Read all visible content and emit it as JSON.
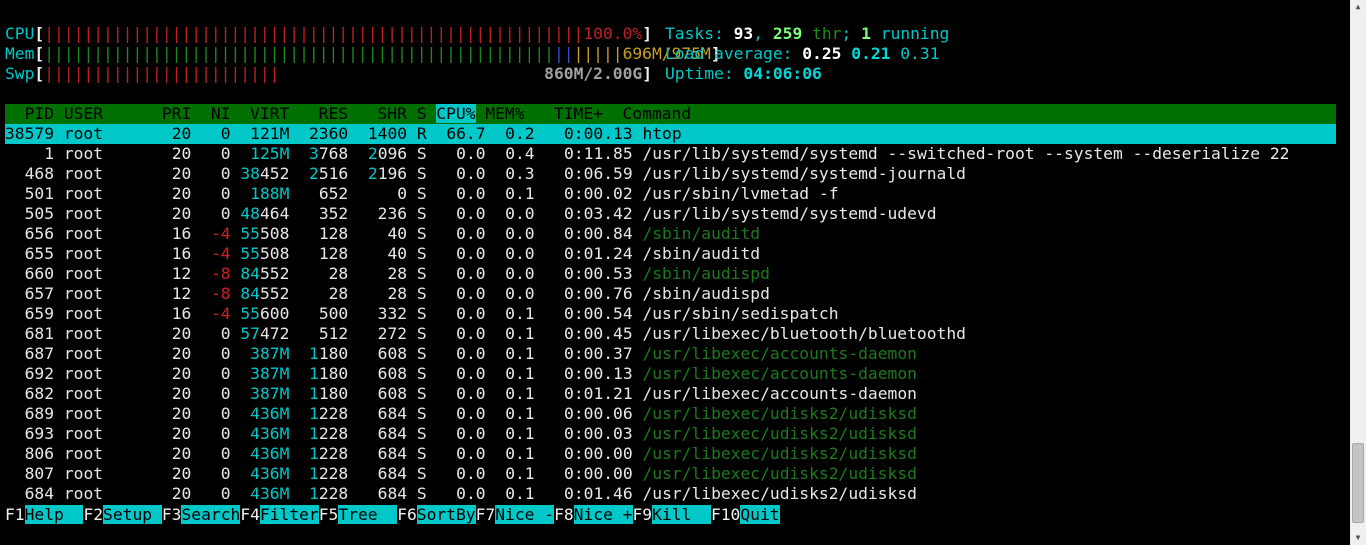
{
  "meters": {
    "cpu": {
      "label": "CPU",
      "bars": "|||||||||||||||||||||||||||||||||||||||||||||||||||||||",
      "value": "100.0%",
      "color": "#c02020"
    },
    "mem": {
      "label": "Mem",
      "bars_used": "||||||||||||||||||||||||||||||||||||||||||||||||||||",
      "bars_buffers": "||",
      "bars_cache": "|||||",
      "value": "696M/975M",
      "colors": {
        "used": "#1c8a1c",
        "buffers": "#3050d0",
        "cache": "#c8a020"
      }
    },
    "swp": {
      "label": "Swp",
      "bars": "||||||||||||||||||||||||",
      "value": "860M/2.00G",
      "color": "#c02020"
    },
    "open_bracket": "[",
    "close_bracket": "]"
  },
  "summary": {
    "tasks_label": "Tasks: ",
    "tasks_count": "93",
    "tasks_sep": ", ",
    "threads": "259",
    "threads_label": " thr",
    "running_sep": "; ",
    "running": "1",
    "running_label": " running",
    "load_label": "Load average: ",
    "load1": "0.25",
    "load5": "0.21",
    "load15": "0.31",
    "uptime_label": "Uptime: ",
    "uptime": "04:06:06"
  },
  "header": {
    "pre": "  PID USER      PRI  NI  VIRT   RES   SHR S ",
    "sort": "CPU%",
    "post": " MEM%   TIME+  Command",
    "sort_column": "CPU%"
  },
  "processes": [
    {
      "pid": "38579",
      "user": "root",
      "pri": "20",
      "ni": "0",
      "virt": "121M",
      "res": "2360",
      "shr": "1400",
      "s": "R",
      "cpu": "66.7",
      "mem": "0.2",
      "time": "0:00.13",
      "cmd": "htop",
      "selected": true
    },
    {
      "pid": "1",
      "user": "root",
      "pri": "20",
      "ni": "0",
      "virt": "125M",
      "res": "3768",
      "shr": "2096",
      "s": "S",
      "cpu": "0.0",
      "mem": "0.4",
      "time": "0:11.85",
      "cmd": "/usr/lib/systemd/systemd --switched-root --system --deserialize 22"
    },
    {
      "pid": "468",
      "user": "root",
      "pri": "20",
      "ni": "0",
      "virt": "38452",
      "res": "2516",
      "shr": "2196",
      "s": "S",
      "cpu": "0.0",
      "mem": "0.3",
      "time": "0:06.59",
      "cmd": "/usr/lib/systemd/systemd-journald"
    },
    {
      "pid": "501",
      "user": "root",
      "pri": "20",
      "ni": "0",
      "virt": "188M",
      "res": "652",
      "shr": "0",
      "s": "S",
      "cpu": "0.0",
      "mem": "0.1",
      "time": "0:00.02",
      "cmd": "/usr/sbin/lvmetad -f"
    },
    {
      "pid": "505",
      "user": "root",
      "pri": "20",
      "ni": "0",
      "virt": "48464",
      "res": "352",
      "shr": "236",
      "s": "S",
      "cpu": "0.0",
      "mem": "0.0",
      "time": "0:03.42",
      "cmd": "/usr/lib/systemd/systemd-udevd"
    },
    {
      "pid": "656",
      "user": "root",
      "pri": "16",
      "ni": "-4",
      "virt": "55508",
      "res": "128",
      "shr": "40",
      "s": "S",
      "cpu": "0.0",
      "mem": "0.0",
      "time": "0:00.84",
      "cmd": "/sbin/auditd",
      "thread": true
    },
    {
      "pid": "655",
      "user": "root",
      "pri": "16",
      "ni": "-4",
      "virt": "55508",
      "res": "128",
      "shr": "40",
      "s": "S",
      "cpu": "0.0",
      "mem": "0.0",
      "time": "0:01.24",
      "cmd": "/sbin/auditd"
    },
    {
      "pid": "660",
      "user": "root",
      "pri": "12",
      "ni": "-8",
      "virt": "84552",
      "res": "28",
      "shr": "28",
      "s": "S",
      "cpu": "0.0",
      "mem": "0.0",
      "time": "0:00.53",
      "cmd": "/sbin/audispd",
      "thread": true
    },
    {
      "pid": "657",
      "user": "root",
      "pri": "12",
      "ni": "-8",
      "virt": "84552",
      "res": "28",
      "shr": "28",
      "s": "S",
      "cpu": "0.0",
      "mem": "0.0",
      "time": "0:00.76",
      "cmd": "/sbin/audispd"
    },
    {
      "pid": "659",
      "user": "root",
      "pri": "16",
      "ni": "-4",
      "virt": "55600",
      "res": "500",
      "shr": "332",
      "s": "S",
      "cpu": "0.0",
      "mem": "0.1",
      "time": "0:00.54",
      "cmd": "/usr/sbin/sedispatch"
    },
    {
      "pid": "681",
      "user": "root",
      "pri": "20",
      "ni": "0",
      "virt": "57472",
      "res": "512",
      "shr": "272",
      "s": "S",
      "cpu": "0.0",
      "mem": "0.1",
      "time": "0:00.45",
      "cmd": "/usr/libexec/bluetooth/bluetoothd"
    },
    {
      "pid": "687",
      "user": "root",
      "pri": "20",
      "ni": "0",
      "virt": "387M",
      "res": "1180",
      "shr": "608",
      "s": "S",
      "cpu": "0.0",
      "mem": "0.1",
      "time": "0:00.37",
      "cmd": "/usr/libexec/accounts-daemon",
      "thread": true
    },
    {
      "pid": "692",
      "user": "root",
      "pri": "20",
      "ni": "0",
      "virt": "387M",
      "res": "1180",
      "shr": "608",
      "s": "S",
      "cpu": "0.0",
      "mem": "0.1",
      "time": "0:00.13",
      "cmd": "/usr/libexec/accounts-daemon",
      "thread": true
    },
    {
      "pid": "682",
      "user": "root",
      "pri": "20",
      "ni": "0",
      "virt": "387M",
      "res": "1180",
      "shr": "608",
      "s": "S",
      "cpu": "0.0",
      "mem": "0.1",
      "time": "0:01.21",
      "cmd": "/usr/libexec/accounts-daemon"
    },
    {
      "pid": "689",
      "user": "root",
      "pri": "20",
      "ni": "0",
      "virt": "436M",
      "res": "1228",
      "shr": "684",
      "s": "S",
      "cpu": "0.0",
      "mem": "0.1",
      "time": "0:00.06",
      "cmd": "/usr/libexec/udisks2/udisksd",
      "thread": true
    },
    {
      "pid": "693",
      "user": "root",
      "pri": "20",
      "ni": "0",
      "virt": "436M",
      "res": "1228",
      "shr": "684",
      "s": "S",
      "cpu": "0.0",
      "mem": "0.1",
      "time": "0:00.03",
      "cmd": "/usr/libexec/udisks2/udisksd",
      "thread": true
    },
    {
      "pid": "806",
      "user": "root",
      "pri": "20",
      "ni": "0",
      "virt": "436M",
      "res": "1228",
      "shr": "684",
      "s": "S",
      "cpu": "0.0",
      "mem": "0.1",
      "time": "0:00.00",
      "cmd": "/usr/libexec/udisks2/udisksd",
      "thread": true
    },
    {
      "pid": "807",
      "user": "root",
      "pri": "20",
      "ni": "0",
      "virt": "436M",
      "res": "1228",
      "shr": "684",
      "s": "S",
      "cpu": "0.0",
      "mem": "0.1",
      "time": "0:00.00",
      "cmd": "/usr/libexec/udisks2/udisksd",
      "thread": true
    },
    {
      "pid": "684",
      "user": "root",
      "pri": "20",
      "ni": "0",
      "virt": "436M",
      "res": "1228",
      "shr": "684",
      "s": "S",
      "cpu": "0.0",
      "mem": "0.1",
      "time": "0:01.46",
      "cmd": "/usr/libexec/udisks2/udisksd"
    }
  ],
  "function_keys": [
    {
      "key": "F1",
      "label": "Help  "
    },
    {
      "key": "F2",
      "label": "Setup "
    },
    {
      "key": "F3",
      "label": "Search"
    },
    {
      "key": "F4",
      "label": "Filter"
    },
    {
      "key": "F5",
      "label": "Tree  "
    },
    {
      "key": "F6",
      "label": "SortBy"
    },
    {
      "key": "F7",
      "label": "Nice -"
    },
    {
      "key": "F8",
      "label": "Nice +"
    },
    {
      "key": "F9",
      "label": "Kill  "
    },
    {
      "key": "F10",
      "label": "Quit"
    }
  ],
  "colors": {
    "highlight": "#00c8c8",
    "header_bg": "#007000",
    "thread_cmd": "#1c7a1c",
    "negative_nice": "#d02020"
  }
}
